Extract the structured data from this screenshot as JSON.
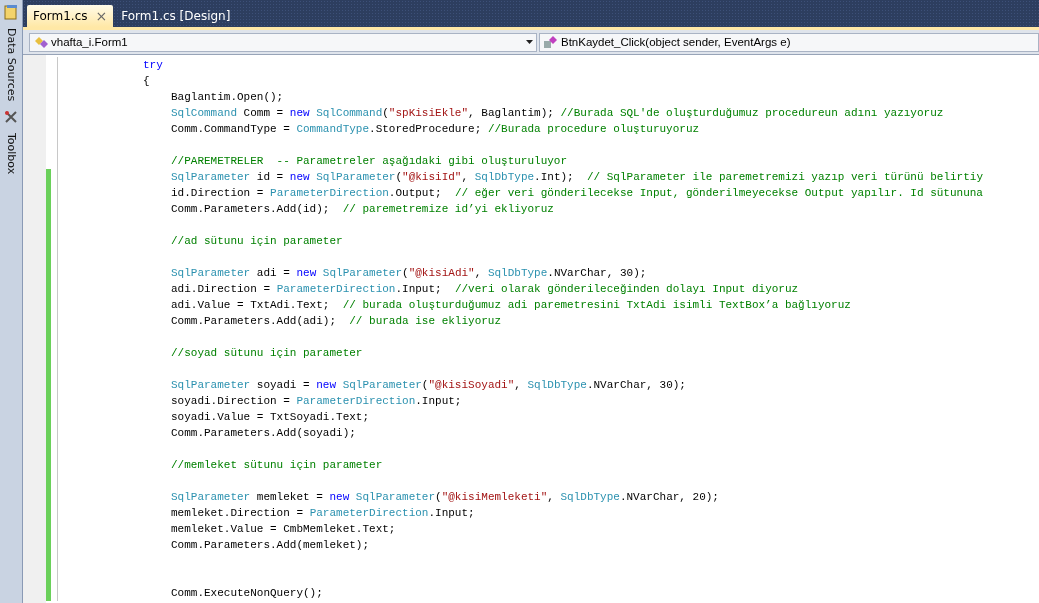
{
  "side_panel": {
    "tabs": [
      {
        "label": "Data Sources"
      },
      {
        "label": "Toolbox"
      }
    ]
  },
  "tabs": [
    {
      "label": "Form1.cs",
      "selected": true,
      "close": "×"
    },
    {
      "label": "Form1.cs [Design]",
      "selected": false
    }
  ],
  "navigation": {
    "class_combo": "vhafta_i.Form1",
    "member_combo": "BtnKaydet_Click(object sender, EventArgs e)"
  },
  "editor": {
    "lines": [
      {
        "changed": false,
        "tokens": [
          {
            "kind": "keyword",
            "text": "try"
          }
        ]
      },
      {
        "changed": false,
        "tokens": [
          {
            "kind": "plain",
            "text": "{"
          }
        ],
        "children": [
          {
            "changed": false,
            "tokens": [
              {
                "kind": "plain",
                "text": "Baglantim.Open();"
              }
            ]
          },
          {
            "changed": false,
            "tokens": [
              {
                "kind": "type",
                "text": "SqlCommand"
              },
              {
                "kind": "plain",
                "text": " Comm = "
              },
              {
                "kind": "keyword",
                "text": "new "
              },
              {
                "kind": "type",
                "text": "SqlCommand"
              },
              {
                "kind": "plain",
                "text": "("
              },
              {
                "kind": "string",
                "text": "\"spKisiEkle\""
              },
              {
                "kind": "plain",
                "text": ", Baglantim); "
              },
              {
                "kind": "comment",
                "text": "//Burada SQL'de oluşturduğumuz procedureun adını yazıyoruz"
              }
            ]
          },
          {
            "changed": false,
            "tokens": [
              {
                "kind": "plain",
                "text": "Comm.CommandType = "
              },
              {
                "kind": "type",
                "text": "CommandType"
              },
              {
                "kind": "plain",
                "text": ".StoredProcedure; "
              },
              {
                "kind": "comment",
                "text": "//Burada procedure oluşturuyoruz"
              }
            ]
          },
          {
            "changed": false
          },
          {
            "changed": false,
            "tokens": [
              {
                "kind": "comment",
                "text": "//PAREMETRELER  -- Parametreler aşağıdaki gibi oluşturuluyor"
              }
            ]
          },
          {
            "changed": true,
            "tokens": [
              {
                "kind": "type",
                "text": "SqlParameter"
              },
              {
                "kind": "plain",
                "text": " id = "
              },
              {
                "kind": "keyword",
                "text": "new "
              },
              {
                "kind": "type",
                "text": "SqlParameter"
              },
              {
                "kind": "plain",
                "text": "("
              },
              {
                "kind": "string",
                "text": "\"@kisiId\""
              },
              {
                "kind": "plain",
                "text": ", "
              },
              {
                "kind": "type",
                "text": "SqlDbType"
              },
              {
                "kind": "plain",
                "text": ".Int);  "
              },
              {
                "kind": "comment",
                "text": "// SqlParameter ile paremetremizi yazıp veri türünü belirtiy"
              }
            ]
          },
          {
            "changed": true,
            "tokens": [
              {
                "kind": "plain",
                "text": "id.Direction = "
              },
              {
                "kind": "type",
                "text": "ParameterDirection"
              },
              {
                "kind": "plain",
                "text": ".Output;  "
              },
              {
                "kind": "comment",
                "text": "// eğer veri gönderilecekse Input, gönderilmeyecekse Output yapılır. Id sütununa"
              }
            ]
          },
          {
            "changed": true,
            "tokens": [
              {
                "kind": "plain",
                "text": "Comm.Parameters.Add(id);  "
              },
              {
                "kind": "comment",
                "text": "// paremetremize id’yi ekliyoruz"
              }
            ]
          },
          {
            "changed": true
          },
          {
            "changed": true,
            "tokens": [
              {
                "kind": "comment",
                "text": "//ad sütunu için parameter"
              }
            ]
          },
          {
            "changed": true
          },
          {
            "changed": true,
            "tokens": [
              {
                "kind": "type",
                "text": "SqlParameter"
              },
              {
                "kind": "plain",
                "text": " adi = "
              },
              {
                "kind": "keyword",
                "text": "new "
              },
              {
                "kind": "type",
                "text": "SqlParameter"
              },
              {
                "kind": "plain",
                "text": "("
              },
              {
                "kind": "string",
                "text": "\"@kisiAdi\""
              },
              {
                "kind": "plain",
                "text": ", "
              },
              {
                "kind": "type",
                "text": "SqlDbType"
              },
              {
                "kind": "plain",
                "text": ".NVarChar, 30);"
              }
            ]
          },
          {
            "changed": true,
            "tokens": [
              {
                "kind": "plain",
                "text": "adi.Direction = "
              },
              {
                "kind": "type",
                "text": "ParameterDirection"
              },
              {
                "kind": "plain",
                "text": ".Input;  "
              },
              {
                "kind": "comment",
                "text": "//veri olarak gönderileceğinden dolayı Input diyoruz"
              }
            ]
          },
          {
            "changed": true,
            "tokens": [
              {
                "kind": "plain",
                "text": "adi.Value = TxtAdi.Text;  "
              },
              {
                "kind": "comment",
                "text": "// burada oluşturduğumuz adi paremetresini TxtAdi isimli TextBox’a bağlıyoruz"
              }
            ]
          },
          {
            "changed": true,
            "tokens": [
              {
                "kind": "plain",
                "text": "Comm.Parameters.Add(adi);  "
              },
              {
                "kind": "comment",
                "text": "// burada ise ekliyoruz"
              }
            ]
          },
          {
            "changed": true
          },
          {
            "changed": true,
            "tokens": [
              {
                "kind": "comment",
                "text": "//soyad sütunu için parameter"
              }
            ]
          },
          {
            "changed": true
          },
          {
            "changed": true,
            "tokens": [
              {
                "kind": "type",
                "text": "SqlParameter"
              },
              {
                "kind": "plain",
                "text": " soyadi = "
              },
              {
                "kind": "keyword",
                "text": "new "
              },
              {
                "kind": "type",
                "text": "SqlParameter"
              },
              {
                "kind": "plain",
                "text": "("
              },
              {
                "kind": "string",
                "text": "\"@kisiSoyadi\""
              },
              {
                "kind": "plain",
                "text": ", "
              },
              {
                "kind": "type",
                "text": "SqlDbType"
              },
              {
                "kind": "plain",
                "text": ".NVarChar, 30);"
              }
            ]
          },
          {
            "changed": true,
            "tokens": [
              {
                "kind": "plain",
                "text": "soyadi.Direction = "
              },
              {
                "kind": "type",
                "text": "ParameterDirection"
              },
              {
                "kind": "plain",
                "text": ".Input;"
              }
            ]
          },
          {
            "changed": true,
            "tokens": [
              {
                "kind": "plain",
                "text": "soyadi.Value = TxtSoyadi.Text;"
              }
            ]
          },
          {
            "changed": true,
            "tokens": [
              {
                "kind": "plain",
                "text": "Comm.Parameters.Add(soyadi);"
              }
            ]
          },
          {
            "changed": true
          },
          {
            "changed": true,
            "tokens": [
              {
                "kind": "comment",
                "text": "//memleket sütunu için parameter"
              }
            ]
          },
          {
            "changed": true
          },
          {
            "changed": true,
            "tokens": [
              {
                "kind": "type",
                "text": "SqlParameter"
              },
              {
                "kind": "plain",
                "text": " memleket = "
              },
              {
                "kind": "keyword",
                "text": "new "
              },
              {
                "kind": "type",
                "text": "SqlParameter"
              },
              {
                "kind": "plain",
                "text": "("
              },
              {
                "kind": "string",
                "text": "\"@kisiMemleketi\""
              },
              {
                "kind": "plain",
                "text": ", "
              },
              {
                "kind": "type",
                "text": "SqlDbType"
              },
              {
                "kind": "plain",
                "text": ".NVarChar, 20);"
              }
            ]
          },
          {
            "changed": true,
            "tokens": [
              {
                "kind": "plain",
                "text": "memleket.Direction = "
              },
              {
                "kind": "type",
                "text": "ParameterDirection"
              },
              {
                "kind": "plain",
                "text": ".Input;"
              }
            ]
          },
          {
            "changed": true,
            "tokens": [
              {
                "kind": "plain",
                "text": "memleket.Value = CmbMemleket.Text;"
              }
            ]
          },
          {
            "changed": true,
            "tokens": [
              {
                "kind": "plain",
                "text": "Comm.Parameters.Add(memleket);"
              }
            ]
          },
          {
            "changed": true
          },
          {
            "changed": true
          },
          {
            "changed": true,
            "tokens": [
              {
                "kind": "plain",
                "text": "Comm.ExecuteNonQuery();"
              }
            ]
          }
        ]
      }
    ]
  }
}
